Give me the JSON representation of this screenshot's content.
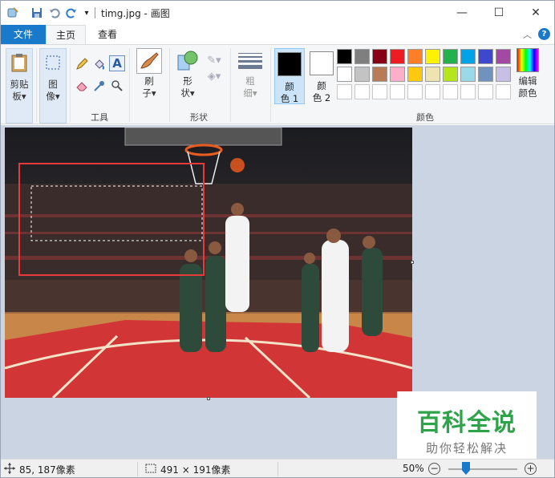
{
  "window": {
    "title": "timg.jpg - 画图",
    "controls": {
      "minimize": "—",
      "maximize": "☐",
      "close": "✕"
    },
    "quick_access_icons": [
      "paint-app-icon",
      "save-icon",
      "undo-icon",
      "redo-icon",
      "customize-dropdown-icon"
    ]
  },
  "tabs": {
    "file": "文件",
    "home": "主页",
    "view": "查看"
  },
  "ribbon": {
    "clipboard": {
      "line1": "剪贴",
      "line2": "板▾"
    },
    "image": {
      "line1": "图",
      "line2": "像▾"
    },
    "tools": {
      "label": "工具",
      "items": [
        "pencil-icon",
        "fill-icon",
        "text-icon",
        "eraser-icon",
        "color-picker-icon",
        "magnifier-icon"
      ]
    },
    "brushes": {
      "line1": "刷",
      "line2": "子▾"
    },
    "shapes": {
      "line1": "形",
      "line2": "状▾",
      "label": "形状"
    },
    "size": {
      "line1": "粗",
      "line2": "细▾"
    },
    "color1": {
      "line1": "颜",
      "line2": "色 1",
      "swatch": "#000000"
    },
    "color2": {
      "line1": "颜",
      "line2": "色 2",
      "swatch": "#ffffff"
    },
    "colors_label": "颜色",
    "edit_colors": {
      "line1": "编辑",
      "line2": "颜色"
    },
    "palette_row1": [
      "#000000",
      "#7f7f7f",
      "#880015",
      "#ed1c24",
      "#ff7f27",
      "#fff200",
      "#22b14c",
      "#00a2e8",
      "#3f48cc",
      "#a349a4"
    ],
    "palette_row2": [
      "#ffffff",
      "#c3c3c3",
      "#b97a57",
      "#ffaec9",
      "#ffc90e",
      "#efe4b0",
      "#b5e61d",
      "#99d9ea",
      "#7092be",
      "#c8bfe7"
    ]
  },
  "watermark": {
    "line1": "百科全说",
    "line2": "助你轻松解决"
  },
  "status": {
    "cursor_pos": "85, 187像素",
    "selection_size": "491 × 191像素",
    "zoom": "50%",
    "zoom_level": 0.5,
    "zoom_out": "−",
    "zoom_in": "+"
  }
}
